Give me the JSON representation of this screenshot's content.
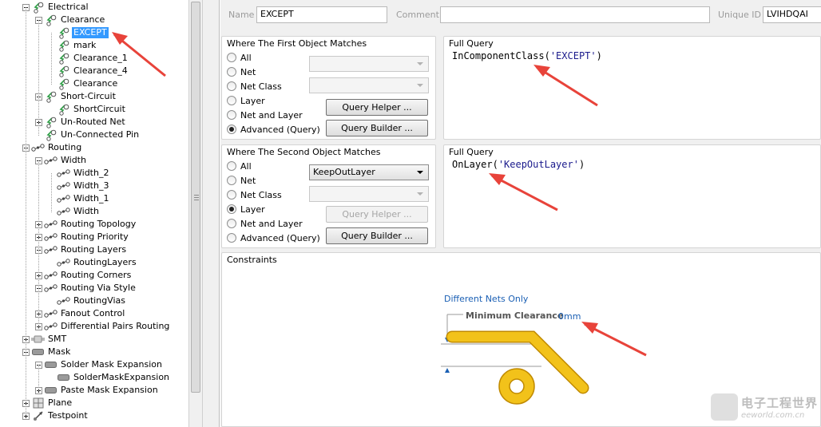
{
  "tree": {
    "items": [
      {
        "label": "Electrical",
        "level": 0,
        "expander": "minus",
        "icon": "electrical-rule-icon"
      },
      {
        "label": "Clearance",
        "level": 1,
        "expander": "minus",
        "icon": "clearance-rule-icon"
      },
      {
        "label": "EXCEPT",
        "level": 2,
        "expander": "none",
        "icon": "clearance-rule-icon",
        "selected": true
      },
      {
        "label": "mark",
        "level": 2,
        "expander": "none",
        "icon": "clearance-rule-icon"
      },
      {
        "label": "Clearance_1",
        "level": 2,
        "expander": "none",
        "icon": "clearance-rule-icon"
      },
      {
        "label": "Clearance_4",
        "level": 2,
        "expander": "none",
        "icon": "clearance-rule-icon"
      },
      {
        "label": "Clearance",
        "level": 2,
        "expander": "none",
        "icon": "clearance-rule-icon"
      },
      {
        "label": "Short-Circuit",
        "level": 1,
        "expander": "minus",
        "icon": "short-circuit-rule-icon"
      },
      {
        "label": "ShortCircuit",
        "level": 2,
        "expander": "none",
        "icon": "short-circuit-rule-icon"
      },
      {
        "label": "Un-Routed Net",
        "level": 1,
        "expander": "plus",
        "icon": "unrouted-net-rule-icon"
      },
      {
        "label": "Un-Connected Pin",
        "level": 1,
        "expander": "blank",
        "icon": "unconnected-pin-rule-icon"
      },
      {
        "label": "Routing",
        "level": 0,
        "expander": "minus",
        "icon": "routing-rule-icon"
      },
      {
        "label": "Width",
        "level": 1,
        "expander": "minus",
        "icon": "width-rule-icon"
      },
      {
        "label": "Width_2",
        "level": 2,
        "expander": "none",
        "icon": "width-rule-icon"
      },
      {
        "label": "Width_3",
        "level": 2,
        "expander": "none",
        "icon": "width-rule-icon"
      },
      {
        "label": "Width_1",
        "level": 2,
        "expander": "none",
        "icon": "width-rule-icon"
      },
      {
        "label": "Width",
        "level": 2,
        "expander": "none",
        "icon": "width-rule-icon"
      },
      {
        "label": "Routing Topology",
        "level": 1,
        "expander": "plus",
        "icon": "routing-rule-icon"
      },
      {
        "label": "Routing Priority",
        "level": 1,
        "expander": "plus",
        "icon": "routing-rule-icon"
      },
      {
        "label": "Routing Layers",
        "level": 1,
        "expander": "minus",
        "icon": "routing-rule-icon"
      },
      {
        "label": "RoutingLayers",
        "level": 2,
        "expander": "none",
        "icon": "routing-rule-icon"
      },
      {
        "label": "Routing Corners",
        "level": 1,
        "expander": "plus",
        "icon": "routing-rule-icon"
      },
      {
        "label": "Routing Via Style",
        "level": 1,
        "expander": "minus",
        "icon": "routing-rule-icon"
      },
      {
        "label": "RoutingVias",
        "level": 2,
        "expander": "none",
        "icon": "routing-rule-icon"
      },
      {
        "label": "Fanout Control",
        "level": 1,
        "expander": "plus",
        "icon": "routing-rule-icon"
      },
      {
        "label": "Differential Pairs Routing",
        "level": 1,
        "expander": "plus",
        "icon": "routing-rule-icon"
      },
      {
        "label": "SMT",
        "level": 0,
        "expander": "plus",
        "icon": "smt-rule-icon"
      },
      {
        "label": "Mask",
        "level": 0,
        "expander": "minus",
        "icon": "mask-rule-icon"
      },
      {
        "label": "Solder Mask Expansion",
        "level": 1,
        "expander": "minus",
        "icon": "mask-rule-icon"
      },
      {
        "label": "SolderMaskExpansion",
        "level": 2,
        "expander": "none",
        "icon": "mask-rule-icon"
      },
      {
        "label": "Paste Mask Expansion",
        "level": 1,
        "expander": "plus",
        "icon": "mask-rule-icon"
      },
      {
        "label": "Plane",
        "level": 0,
        "expander": "plus",
        "icon": "plane-rule-icon"
      },
      {
        "label": "Testpoint",
        "level": 0,
        "expander": "plus",
        "icon": "testpoint-rule-icon"
      }
    ]
  },
  "rule": {
    "name_label": "Name",
    "name_value": "EXCEPT",
    "comment_label": "Comment",
    "comment_value": "",
    "uid_label": "Unique ID",
    "uid_value": "LVIHDQAI"
  },
  "first_match": {
    "title": "Where The First Object Matches",
    "options": [
      "All",
      "Net",
      "Net Class",
      "Layer",
      "Net and Layer",
      "Advanced (Query)"
    ],
    "selected_index": 5,
    "combo1_value": "",
    "combo2_value": "",
    "query_helper_label": "Query Helper ...",
    "query_builder_label": "Query Builder ...",
    "full_query_title": "Full Query",
    "query_func": "InComponentClass",
    "query_arg": "'EXCEPT'"
  },
  "second_match": {
    "title": "Where The Second Object Matches",
    "options": [
      "All",
      "Net",
      "Net Class",
      "Layer",
      "Net and Layer",
      "Advanced (Query)"
    ],
    "selected_index": 3,
    "combo1_value": "KeepOutLayer",
    "combo2_value": "",
    "query_helper_label": "Query Helper ...",
    "query_builder_label": "Query Builder ...",
    "full_query_title": "Full Query",
    "query_func": "OnLayer",
    "query_arg": "'KeepOutLayer'"
  },
  "constraints": {
    "title": "Constraints",
    "nets_mode": "Different Nets Only",
    "min_clearance_label": "Minimum Clearance",
    "min_clearance_value": "0mm"
  },
  "watermark": {
    "line1": "电子工程世界",
    "line2": "eeworld.com.cn"
  },
  "colors": {
    "selection": "#3399ff",
    "track": "#f2c21a",
    "track_outline": "#c08a00",
    "link_blue": "#1a5fb4",
    "annotation_arrow": "#e8433a"
  }
}
